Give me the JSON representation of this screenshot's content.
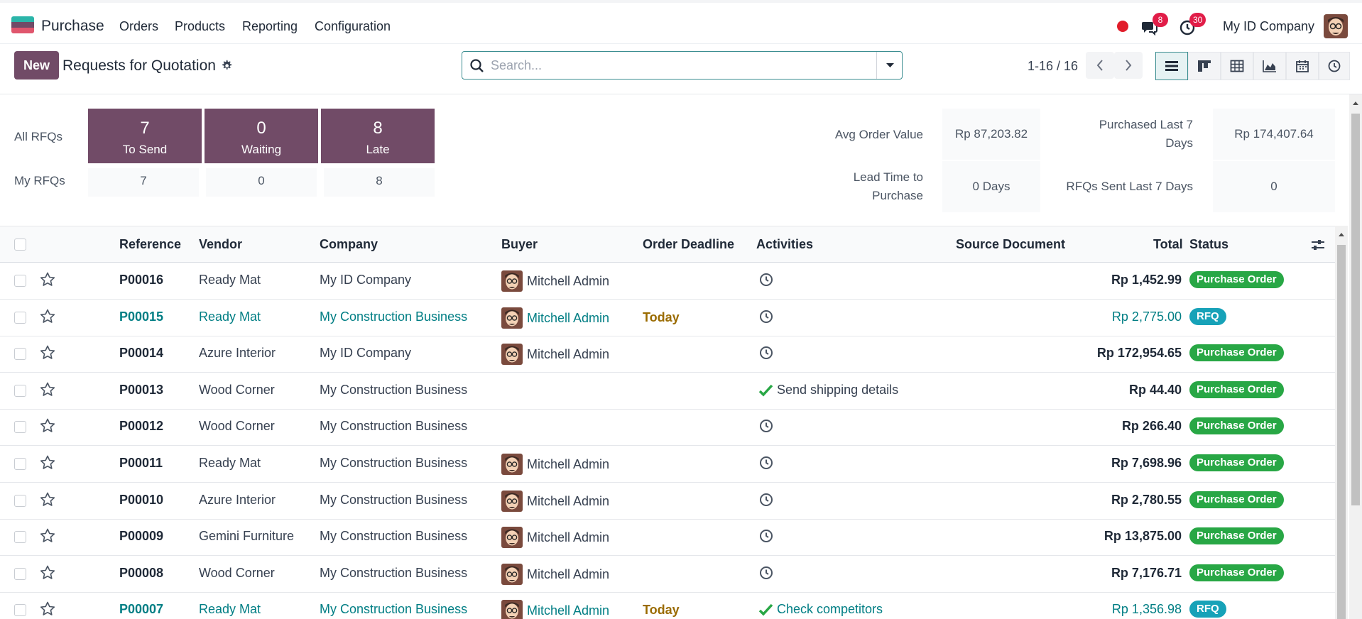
{
  "nav": {
    "brand": "Purchase",
    "menus": [
      "Orders",
      "Products",
      "Reporting",
      "Configuration"
    ],
    "messages_badge": "8",
    "activities_badge": "30",
    "company": "My ID Company"
  },
  "control": {
    "new_label": "New",
    "title": "Requests for Quotation",
    "search_placeholder": "Search...",
    "pager": "1-16 / 16"
  },
  "dashboard": {
    "all_rfqs_label": "All RFQs",
    "my_rfqs_label": "My RFQs",
    "boxes": [
      {
        "count": "7",
        "label": "To Send"
      },
      {
        "count": "0",
        "label": "Waiting"
      },
      {
        "count": "8",
        "label": "Late"
      }
    ],
    "my_counts": [
      "7",
      "0",
      "8"
    ],
    "kpis": {
      "avg_order_value_label": "Avg Order Value",
      "avg_order_value": "Rp 87,203.82",
      "purchased_last_7_label_1": "Purchased Last 7",
      "purchased_last_7_label_2": "Days",
      "purchased_last_7": "Rp 174,407.64",
      "lead_time_label_1": "Lead Time to",
      "lead_time_label_2": "Purchase",
      "lead_time": "0 Days",
      "rfqs_sent_label": "RFQs Sent Last 7 Days",
      "rfqs_sent": "0"
    }
  },
  "table": {
    "headers": {
      "reference": "Reference",
      "vendor": "Vendor",
      "company": "Company",
      "buyer": "Buyer",
      "order_deadline": "Order Deadline",
      "activities": "Activities",
      "source_document": "Source Document",
      "total": "Total",
      "status": "Status"
    },
    "rows": [
      {
        "reference": "P00016",
        "vendor": "Ready Mat",
        "company": "My ID Company",
        "buyer": "Mitchell Admin",
        "deadline": "",
        "activity": "",
        "total": "Rp 1,452.99",
        "status": "Purchase Order"
      },
      {
        "reference": "P00015",
        "vendor": "Ready Mat",
        "company": "My Construction Business",
        "buyer": "Mitchell Admin",
        "deadline": "Today",
        "activity": "",
        "total": "Rp 2,775.00",
        "status": "RFQ"
      },
      {
        "reference": "P00014",
        "vendor": "Azure Interior",
        "company": "My ID Company",
        "buyer": "Mitchell Admin",
        "deadline": "",
        "activity": "",
        "total": "Rp 172,954.65",
        "status": "Purchase Order"
      },
      {
        "reference": "P00013",
        "vendor": "Wood Corner",
        "company": "My Construction Business",
        "buyer": "",
        "deadline": "",
        "activity": "Send shipping details",
        "total": "Rp 44.40",
        "status": "Purchase Order"
      },
      {
        "reference": "P00012",
        "vendor": "Wood Corner",
        "company": "My Construction Business",
        "buyer": "",
        "deadline": "",
        "activity": "",
        "total": "Rp 266.40",
        "status": "Purchase Order"
      },
      {
        "reference": "P00011",
        "vendor": "Ready Mat",
        "company": "My Construction Business",
        "buyer": "Mitchell Admin",
        "deadline": "",
        "activity": "",
        "total": "Rp 7,698.96",
        "status": "Purchase Order"
      },
      {
        "reference": "P00010",
        "vendor": "Azure Interior",
        "company": "My Construction Business",
        "buyer": "Mitchell Admin",
        "deadline": "",
        "activity": "",
        "total": "Rp 2,780.55",
        "status": "Purchase Order"
      },
      {
        "reference": "P00009",
        "vendor": "Gemini Furniture",
        "company": "My Construction Business",
        "buyer": "Mitchell Admin",
        "deadline": "",
        "activity": "",
        "total": "Rp 13,875.00",
        "status": "Purchase Order"
      },
      {
        "reference": "P00008",
        "vendor": "Wood Corner",
        "company": "My Construction Business",
        "buyer": "Mitchell Admin",
        "deadline": "",
        "activity": "",
        "total": "Rp 7,176.71",
        "status": "Purchase Order"
      },
      {
        "reference": "P00007",
        "vendor": "Ready Mat",
        "company": "My Construction Business",
        "buyer": "Mitchell Admin",
        "deadline": "Today",
        "activity": "Check competitors",
        "total": "Rp 1,356.98",
        "status": "RFQ"
      }
    ]
  },
  "colors": {
    "primary": "#714b67",
    "link": "#017e84",
    "purchase_order": "#28a745",
    "rfq": "#17a2b8",
    "deadline_today": "#9a6b00"
  }
}
